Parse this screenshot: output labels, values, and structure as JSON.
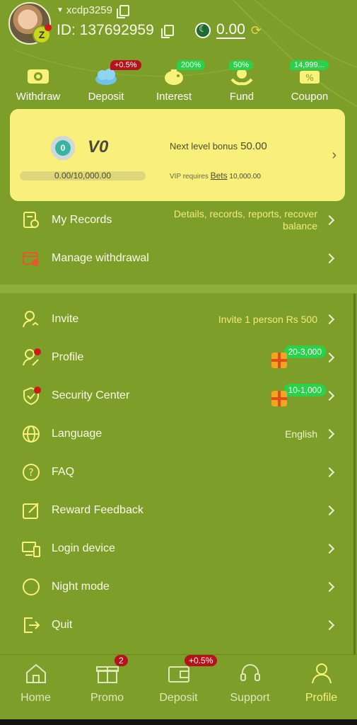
{
  "header": {
    "username": "xcdp3259",
    "id_text": "ID: 137692959",
    "balance": "0.00",
    "avatar_badge": "Z"
  },
  "quick_actions": [
    {
      "label": "Withdraw",
      "badge": ""
    },
    {
      "label": "Deposit",
      "badge": "+0.5%"
    },
    {
      "label": "Interest",
      "badge": "200%"
    },
    {
      "label": "Fund",
      "badge": "50%"
    },
    {
      "label": "Coupon",
      "badge": "14,999..."
    }
  ],
  "vip": {
    "medal": "0",
    "level": "V0",
    "progress_text": "0.00/10,000.00",
    "progress_fraction": 0.0,
    "next_label": "Next level bonus",
    "next_amount": "50.00",
    "req_label": "VIP requires",
    "req_link": "Bets",
    "req_amount": "10,000.00"
  },
  "records": [
    {
      "label": "My Records",
      "detail_1": "Details, records, reports, recover",
      "detail_2": "balance"
    },
    {
      "label": "Manage withdrawal"
    }
  ],
  "menu": [
    {
      "label": "Invite",
      "detail": "Invite 1 person Rs 500"
    },
    {
      "label": "Profile",
      "badge": "20-3,000"
    },
    {
      "label": "Security Center",
      "badge": "10-1,000"
    },
    {
      "label": "Language",
      "detail": "English"
    },
    {
      "label": "FAQ"
    },
    {
      "label": "Reward Feedback"
    },
    {
      "label": "Login device"
    },
    {
      "label": "Night mode"
    },
    {
      "label": "Quit"
    }
  ],
  "bottom_nav": [
    {
      "label": "Home",
      "badge": ""
    },
    {
      "label": "Promo",
      "badge": "2"
    },
    {
      "label": "Deposit",
      "badge": "+0.5%"
    },
    {
      "label": "Support",
      "badge": ""
    },
    {
      "label": "Profile",
      "badge": ""
    }
  ],
  "colors": {
    "background": "#7d9e28",
    "accent_yellow": "#f7f27a",
    "vip_card": "#f9f07b",
    "badge_red": "#b5121b",
    "badge_green": "#2bd14a"
  }
}
